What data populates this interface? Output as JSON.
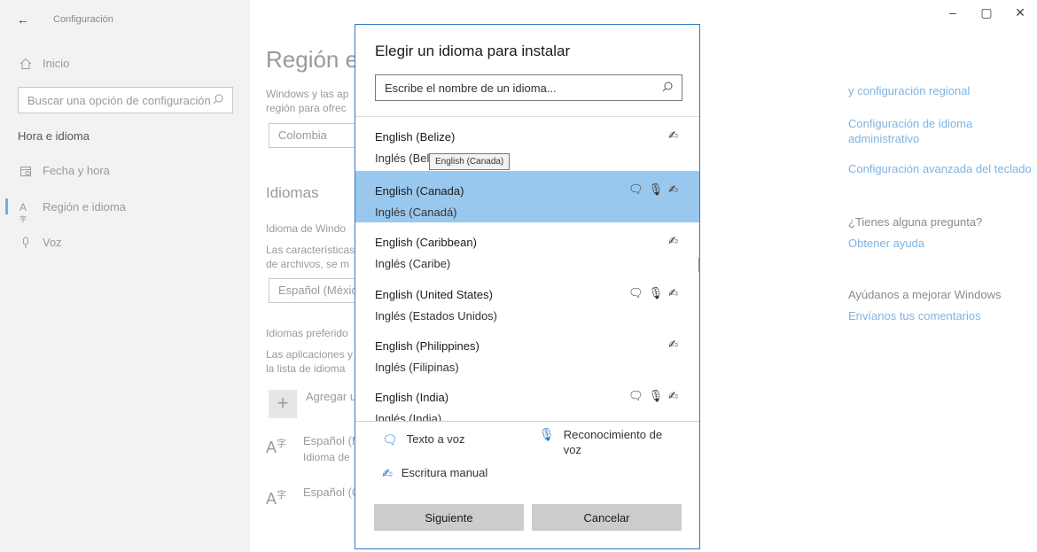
{
  "titlebar": {
    "back_glyph": "←",
    "title": "Configuración"
  },
  "window_controls": [
    "–",
    "▢",
    "✕"
  ],
  "sidebar": {
    "home": "Inicio",
    "search_placeholder": "Buscar una opción de configuración",
    "section": "Hora e idioma",
    "items": [
      {
        "label": "Fecha y hora",
        "icon": "calendar-icon"
      },
      {
        "label": "Región e idioma",
        "icon": "language-icon",
        "selected": true
      },
      {
        "label": "Voz",
        "icon": "microphone-icon"
      }
    ]
  },
  "main": {
    "title": "Región e",
    "desc1": "Windows y las ap",
    "desc2": "región para ofrec",
    "country": "Colombia",
    "languages_heading": "Idiomas",
    "display_lang_label": "Idioma de Windo",
    "display_lang_desc1": "Las características",
    "display_lang_desc2": "de archivos, se m",
    "display_lang_value": "Español (México",
    "preferred_label": "Idiomas preferido",
    "preferred_desc1": "Las aplicaciones y",
    "preferred_desc2": "la lista de idioma",
    "add_label": "Agregar u",
    "langs": [
      {
        "name": "Español (M",
        "sub": "Idioma de"
      },
      {
        "name": "Español (C",
        "sub": ""
      }
    ]
  },
  "right": {
    "link1": "y configuración regional",
    "link2_line1": "Configuración de idioma",
    "link2_line2": "administrativo",
    "link3": "Configuración avanzada del teclado",
    "question": "¿Tienes alguna pregunta?",
    "help_link": "Obtener ayuda",
    "improve": "Ayúdanos a mejorar Windows",
    "feedback_link": "Envíanos tus comentarios"
  },
  "dialog": {
    "title": "Elegir un idioma para instalar",
    "search_placeholder": "Escribe el nombre de un idioma...",
    "tooltip": "English (Canada)",
    "languages": [
      {
        "name": "English (Belize)",
        "native": "Inglés (Belice)",
        "features": [
          "handwriting"
        ]
      },
      {
        "name": "English (Canada)",
        "native": "Inglés (Canadá)",
        "features": [
          "tts",
          "speech",
          "handwriting"
        ],
        "selected": true
      },
      {
        "name": "English (Caribbean)",
        "native": "Inglés (Caribe)",
        "features": [
          "handwriting"
        ]
      },
      {
        "name": "English (United States)",
        "native": "Inglés (Estados Unidos)",
        "features": [
          "tts",
          "speech",
          "handwriting"
        ]
      },
      {
        "name": "English (Philippines)",
        "native": "Inglés (Filipinas)",
        "features": [
          "handwriting"
        ]
      },
      {
        "name": "English (India)",
        "native": "Inglés (India)",
        "features": [
          "tts",
          "speech",
          "handwriting"
        ]
      }
    ],
    "legend": {
      "tts": "Texto a voz",
      "speech_line1": "Reconocimiento de",
      "speech_line2": "voz",
      "handwriting": "Escritura manual"
    },
    "next_button": "Siguiente",
    "cancel_button": "Cancelar"
  },
  "colors": {
    "accent": "#0063b1",
    "selection": "#99c8ef",
    "link": "#7fb4e0",
    "dialog_border": "#2b78c2"
  }
}
